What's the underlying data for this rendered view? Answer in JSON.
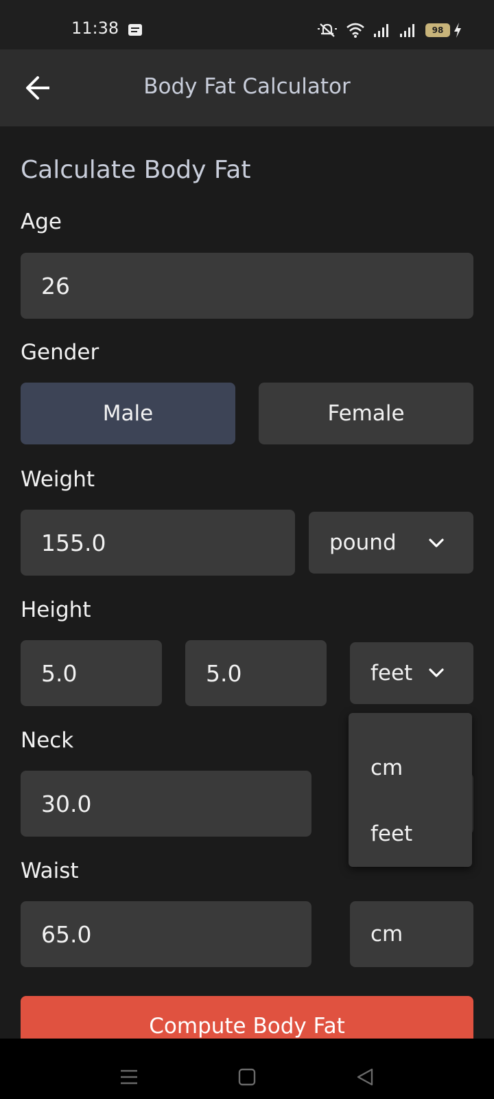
{
  "status_bar": {
    "time": "11:38",
    "battery": "98",
    "icons": [
      "message-icon",
      "mute-icon",
      "wifi-icon",
      "signal-icon",
      "signal-icon",
      "battery-icon",
      "charging-icon"
    ]
  },
  "app_bar": {
    "title": "Body Fat Calculator",
    "back_icon": "arrow-left-icon"
  },
  "form": {
    "section_title": "Calculate Body Fat",
    "age": {
      "label": "Age",
      "value": "26"
    },
    "gender": {
      "label": "Gender",
      "options": [
        "Male",
        "Female"
      ],
      "selected": "Male"
    },
    "weight": {
      "label": "Weight",
      "value": "155.0",
      "unit": "pound"
    },
    "height": {
      "label": "Height",
      "value1": "5.0",
      "value2": "5.0",
      "unit": "feet"
    },
    "neck": {
      "label": "Neck",
      "value": "30.0"
    },
    "waist": {
      "label": "Waist",
      "value": "65.0",
      "unit": "cm"
    },
    "height_unit_menu": [
      "cm",
      "feet"
    ],
    "compute_label": "Compute Body Fat"
  },
  "colors": {
    "background": "#1b1b1b",
    "field": "#3a3a3a",
    "selected_segment": "#3d4456",
    "accent": "#e05240",
    "title_text": "#c9cedb"
  },
  "nav_bar": {
    "icons": [
      "menu-icon",
      "home-square-icon",
      "back-triangle-icon"
    ]
  }
}
